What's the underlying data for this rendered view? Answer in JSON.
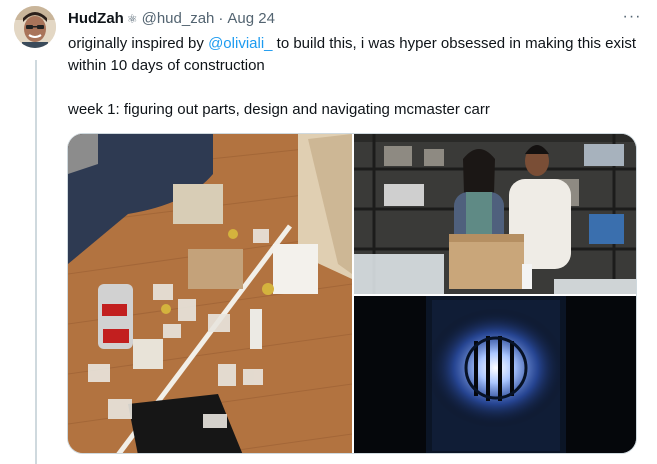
{
  "tweet": {
    "author": {
      "display_name": "HudZah",
      "name_emoji": "⚛",
      "handle": "@hud_zah",
      "separator": "·",
      "date": "Aug 24"
    },
    "more_label": "···",
    "text": {
      "line1_pre": "originally inspired by ",
      "mention": "@oliviali_",
      "line1_post": " to build this, i was hyper obsessed in making this exist within 10 days of construction",
      "line2": "week 1: figuring out parts, design and navigating mcmaster carr"
    },
    "media": {
      "count": 3,
      "images": [
        {
          "subject": "parts-on-floor-photo"
        },
        {
          "subject": "two-people-in-lab-photo"
        },
        {
          "subject": "glowing-fusor-photo"
        }
      ]
    },
    "colors": {
      "mention": "#1d9bf0",
      "secondary_text": "#536471",
      "thread_line": "#cfd9de"
    }
  }
}
